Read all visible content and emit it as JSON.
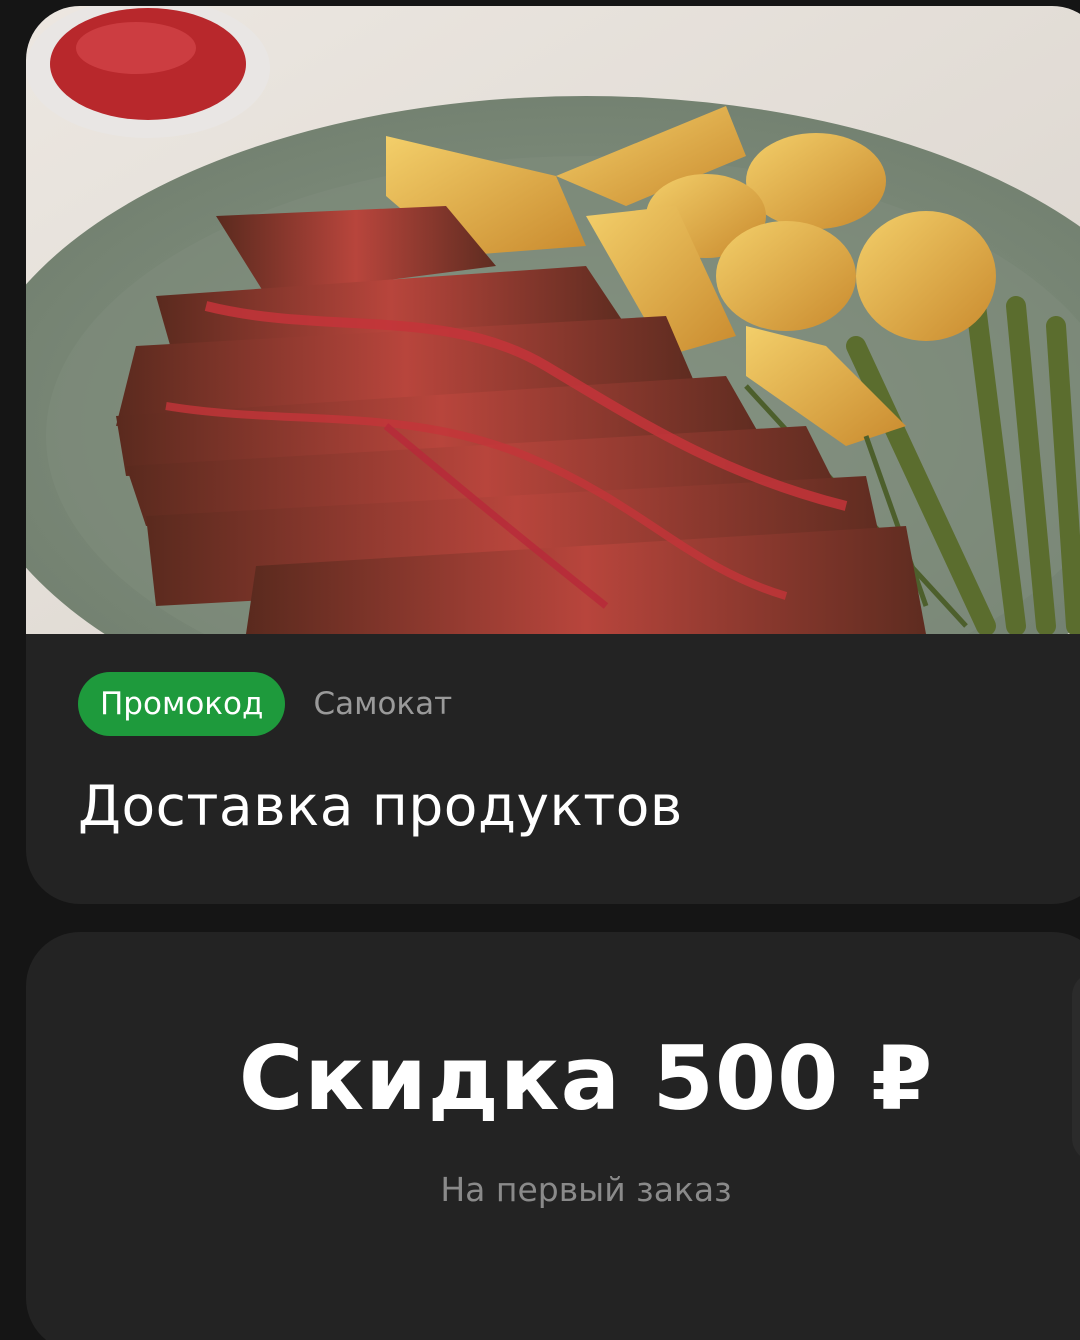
{
  "offer": {
    "image_alt": "Стейк с картофелем и спаржей",
    "promo_label": "Промокод",
    "brand": "Самокат",
    "title": "Доставка продуктов"
  },
  "discount": {
    "amount": "Скидка 500 ₽",
    "note": "На первый заказ"
  },
  "colors": {
    "background": "#151515",
    "card": "#232323",
    "badge_green": "#1e9a3c",
    "muted_text": "#9a9a9a"
  }
}
